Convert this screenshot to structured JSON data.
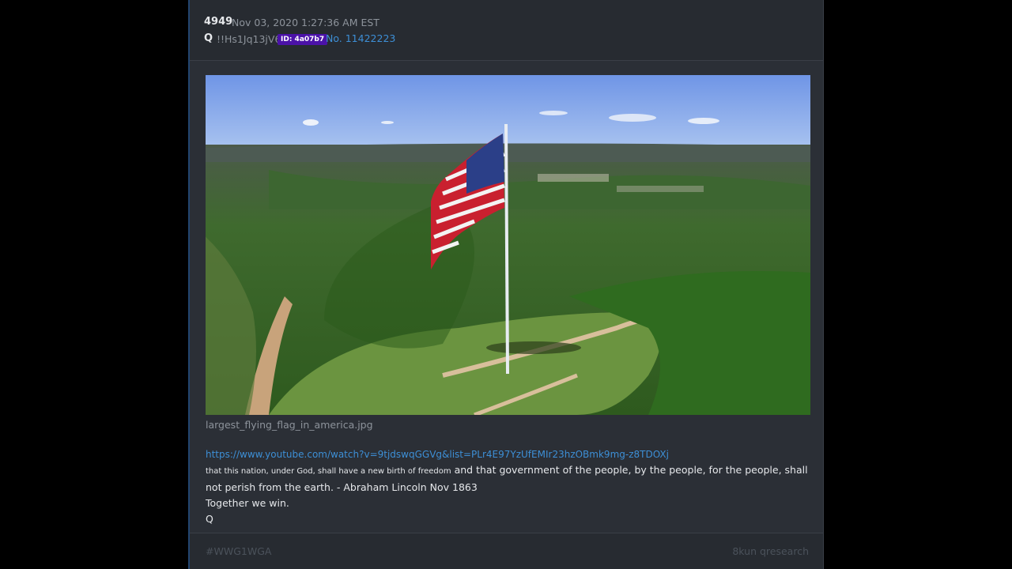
{
  "post": {
    "number": "4949",
    "date": "Nov 03, 2020 1:27:36 AM EST",
    "author": "Q",
    "tripcode": "!!Hs1Jq13jV6",
    "id_badge": "ID: 4a07b7",
    "post_link": "No. 11422223"
  },
  "image": {
    "filename": "largest_flying_flag_in_america.jpg"
  },
  "body": {
    "link": "https://www.youtube.com/watch?v=9tjdswqGGVg&list=PLr4E97YzUfEMIr23hzOBmk9mg-z8TDOXj",
    "quote_small": "that this nation, under God, shall have a new birth of freedom",
    "quote_rest": " and that government of the people, by the people, for the people, shall not perish from the earth. - Abraham Lincoln Nov 1863",
    "line2": "Together we win.",
    "signature": "Q"
  },
  "footer": {
    "hashtag": "#WWG1WGA",
    "board": "8kun qresearch"
  },
  "colors": {
    "background": "#000000",
    "card": "#2b2f36",
    "link": "#3d8fd6",
    "badge": "#4b12a8"
  }
}
